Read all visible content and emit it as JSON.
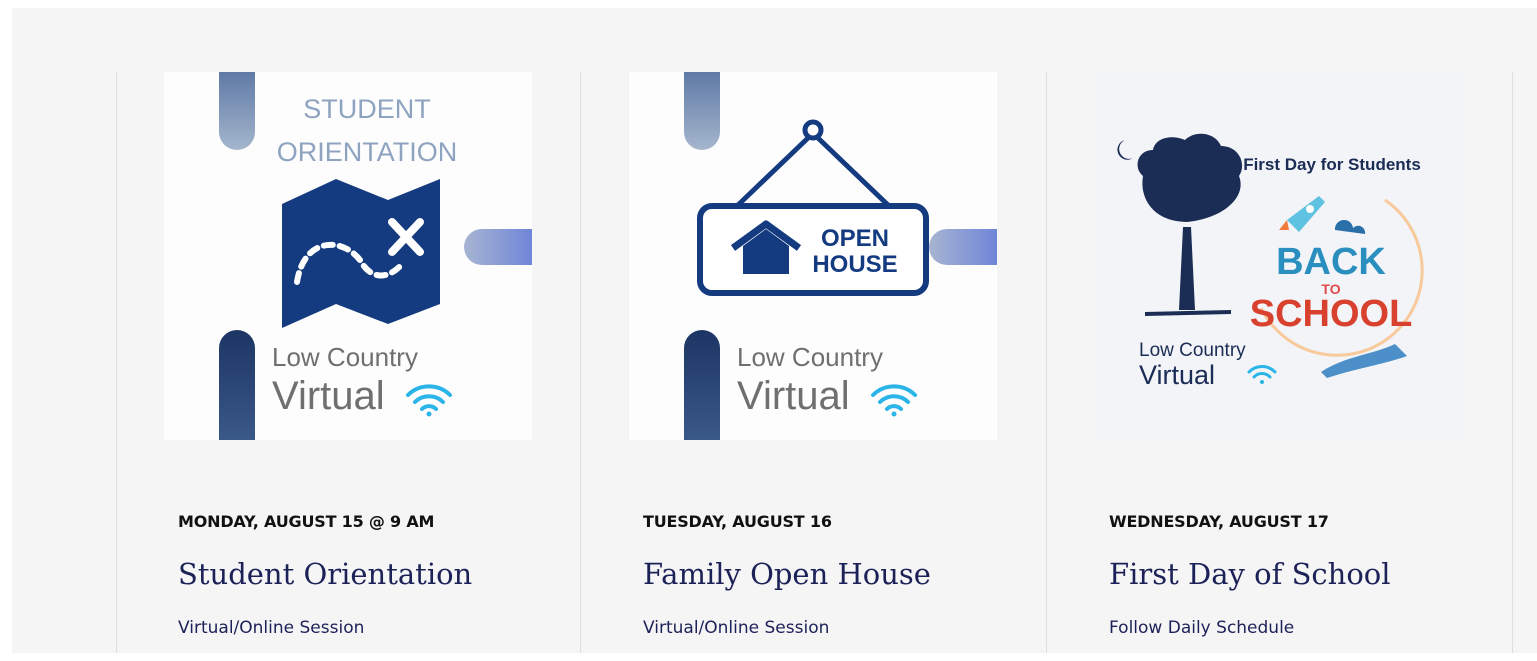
{
  "events": [
    {
      "image_text": {
        "line1": "STUDENT",
        "line2": "ORIENTATION",
        "brand1": "Low Country",
        "brand2": "Virtual"
      },
      "date": "MONDAY, AUGUST 15 @ 9 AM",
      "title": "Student Orientation",
      "subtitle": "Virtual/Online Session"
    },
    {
      "image_text": {
        "sign1": "OPEN",
        "sign2": "HOUSE",
        "brand1": "Low Country",
        "brand2": "Virtual"
      },
      "date": "TUESDAY, AUGUST 16",
      "title": "Family Open House",
      "subtitle": "Virtual/Online Session"
    },
    {
      "image_text": {
        "heading": "First Day for Students",
        "back": "BACK",
        "to": "TO",
        "school": "SCHOOL",
        "brand1": "Low Country",
        "brand2": "Virtual"
      },
      "date": "WEDNESDAY, AUGUST 17",
      "title": "First Day of School",
      "subtitle": "Follow Daily Schedule"
    }
  ],
  "colors": {
    "background": "#f5f5f5",
    "title": "#1c2158",
    "date": "#111111",
    "navy_icon": "#143a80"
  }
}
